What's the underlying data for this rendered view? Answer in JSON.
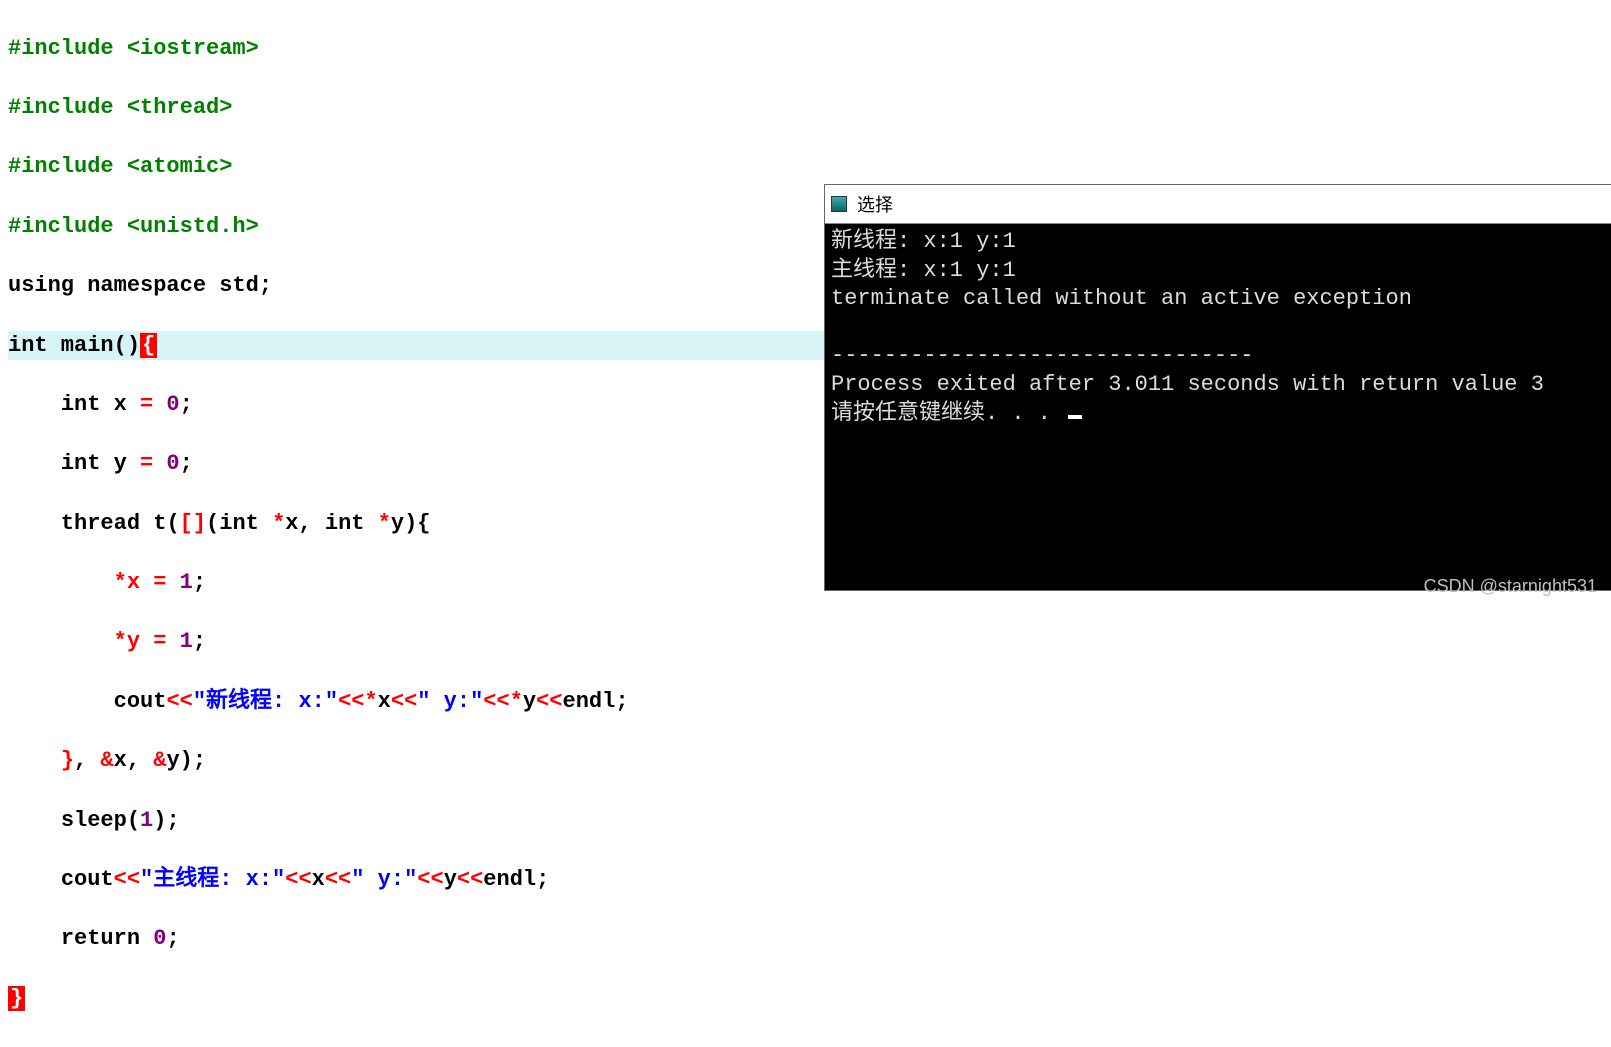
{
  "code": {
    "inc1": "#include <iostream>",
    "inc2": "#include <thread>",
    "inc3": "#include <atomic>",
    "inc4": "#include <unistd.h>",
    "using_kw": "using namespace",
    "using_ns": " std",
    "semi": ";",
    "int_kw": "int",
    "main_id": " main",
    "lparen": "(",
    "rparen": ")",
    "lbrace": "{",
    "rbrace": "}",
    "x_id": " x ",
    "y_id": " y ",
    "eq": "=",
    "zero": " 0",
    "one": " 1",
    "thread_id": "thread ",
    "t_id": "t",
    "lbracket": "[",
    "rbracket": "]",
    "star": "*",
    "comma": ", ",
    "star_x": "*x ",
    "star_y": "*y ",
    "cout_id": "cout",
    "llt": "<<",
    "str1": "\"新线程: x:\"",
    "str2": "\" y:\"",
    "str3": "\"主线程: x:\"",
    "endl_id": "endl",
    "amp": "&",
    "sleep_id": "sleep",
    "sleep_arg": "1",
    "return_kw": "return",
    "x_plain": "x",
    "y_plain": "y"
  },
  "console": {
    "title": "选择",
    "line1": "新线程: x:1 y:1",
    "line2": "主线程: x:1 y:1",
    "line3": "terminate called without an active exception",
    "sep": "--------------------------------",
    "line4": "Process exited after 3.011 seconds with return value 3",
    "line5": "请按任意键继续. . . "
  },
  "watermark": "CSDN @starnight531"
}
